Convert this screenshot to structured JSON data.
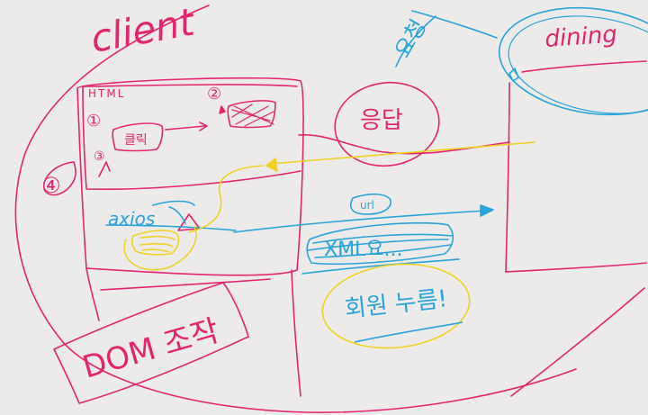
{
  "colors": {
    "magenta": "#e3256f",
    "blue": "#2aa3d9",
    "yellow": "#eed225",
    "background": "#ecebe9"
  },
  "labels": {
    "client": "client",
    "html": "HTML",
    "step_one": "①",
    "step_two": "②",
    "step_three": "③",
    "step_four": "④",
    "click": "클릭",
    "axios": "axios",
    "response": "응답",
    "dining": "dining",
    "request": "요청",
    "url": "url",
    "xml": "XML요...",
    "dom": "DOM 조작",
    "note": "회원 누름!"
  }
}
